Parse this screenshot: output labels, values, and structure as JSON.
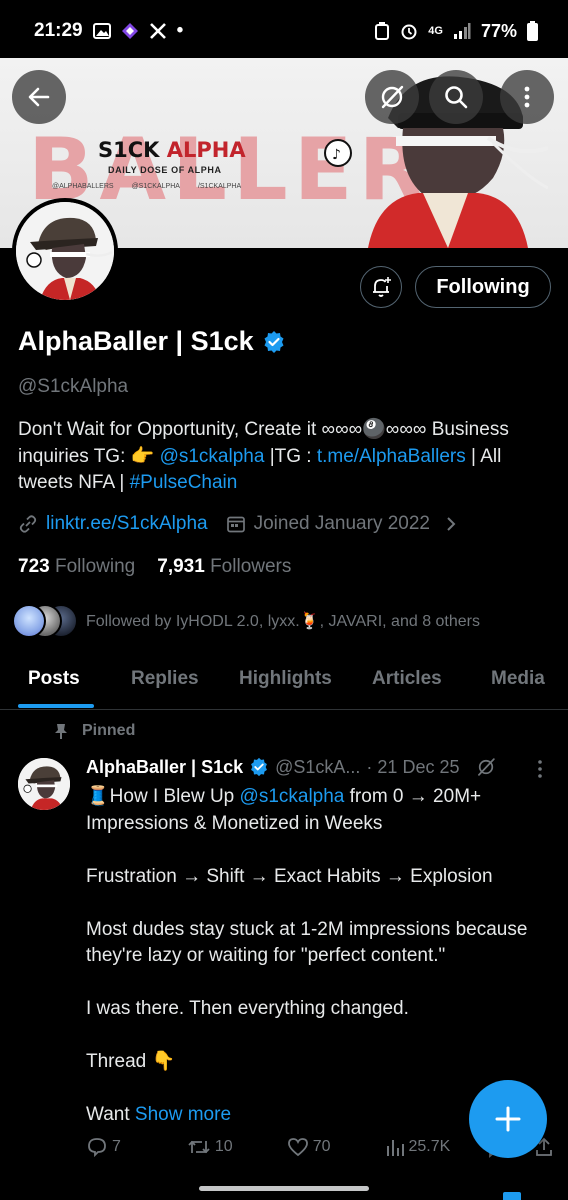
{
  "status_bar": {
    "time": "21:29",
    "battery": "77%",
    "network": "4G",
    "notif_dot": "•"
  },
  "banner": {
    "big_text": "BALLER",
    "brand_a": "S1CK",
    "brand_b": "ALPHA",
    "tagline": "DAILY DOSE OF ALPHA",
    "socials": [
      "@ALPHABALLERS",
      "@S1CKALPHA",
      "/S1CKALPHA"
    ]
  },
  "profile": {
    "display_name": "AlphaBaller | S1ck",
    "handle": "@S1ckAlpha",
    "bio_line_1": "Don't Wait for Opportunity, Create it ∞∞∞🎱∞∞∞  Business",
    "bio_line_2_pre": "inquiries TG: 👉 ",
    "bio_mention": "@s1ckalpha",
    "bio_line_2_mid": " |TG : ",
    "bio_tg_link": "t.me/AlphaBallers",
    "bio_line_2_post": " | All",
    "bio_line_3_pre": "tweets NFA | ",
    "bio_hashtag": "#PulseChain",
    "website": "linktr.ee/S1ckAlpha",
    "joined": "Joined January 2022",
    "following_count": "723",
    "following_label": "Following",
    "followers_count": "7,931",
    "followers_label": "Followers",
    "followed_by": "Followed by IyHODL 2.0, lyxx.🍹, JAVARI, and 8 others",
    "following_button": "Following"
  },
  "tabs": [
    {
      "label": "Posts",
      "active": true
    },
    {
      "label": "Replies",
      "active": false
    },
    {
      "label": "Highlights",
      "active": false
    },
    {
      "label": "Articles",
      "active": false
    },
    {
      "label": "Media",
      "active": false
    }
  ],
  "post": {
    "pinned_label": "Pinned",
    "name": "AlphaBaller | S1ck",
    "handle": "@S1ckA...",
    "date": "· 21 Dec 25",
    "line_1_pre": "🧵How I Blew Up ",
    "line_1_mention": "@s1ckalpha",
    "line_1_post": " from 0 → 20M+",
    "line_2": "Impressions & Monetized in Weeks",
    "para_2": "Frustration → Shift → Exact Habits → Explosion",
    "para_3": "Most dudes stay stuck at 1-2M impressions because they're lazy or waiting for \"perfect content.\"",
    "para_4": "I was there. Then everything changed.",
    "para_5": "Thread 👇",
    "last_line": "Want ",
    "show_more": "Show more",
    "replies": "7",
    "reposts": "10",
    "likes": "70",
    "views": "25.7K"
  },
  "colors": {
    "accent": "#1d9bf0",
    "verified": "#1d9bf0",
    "muted": "#71767b",
    "banner_red": "#c2242c"
  }
}
